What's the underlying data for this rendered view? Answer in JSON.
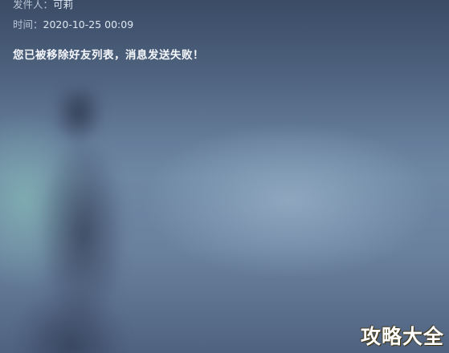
{
  "mail": {
    "sender_label": "发件人：",
    "sender_name": "可莉",
    "time_label": "时间：",
    "time_value": "2020-10-25 00:09",
    "body": "您已被移除好友列表，消息发送失败！"
  },
  "watermark": {
    "text": "攻略大全"
  }
}
